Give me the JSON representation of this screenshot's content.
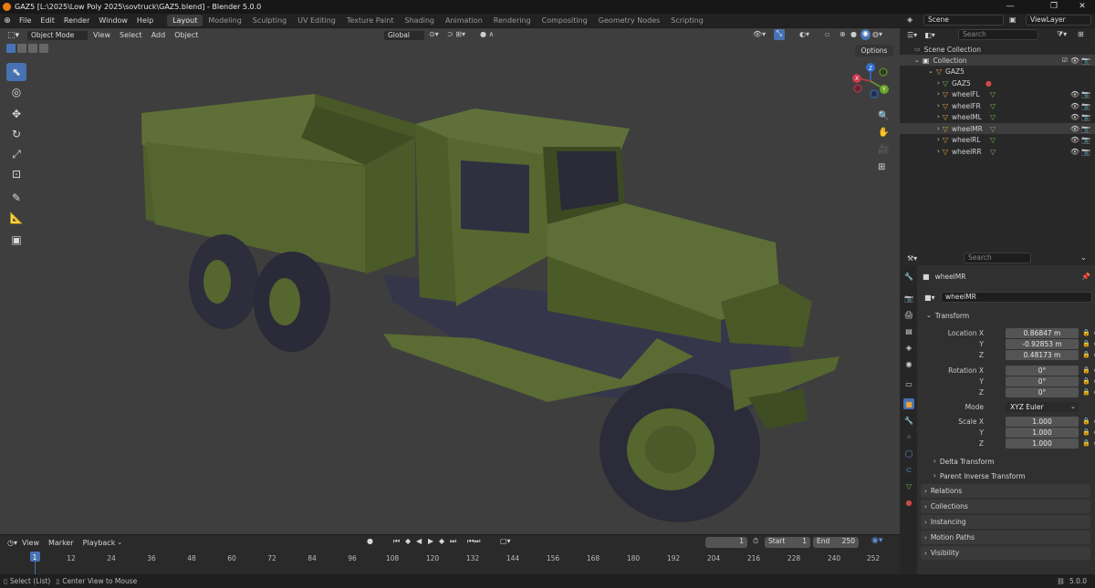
{
  "window": {
    "title": "GAZ5 [L:\\2025\\Low Poly 2025\\sovtruck\\GAZ5.blend] - Blender 5.0.0",
    "controls": [
      "—",
      "❐",
      "✕"
    ]
  },
  "menus": [
    "File",
    "Edit",
    "Render",
    "Window",
    "Help"
  ],
  "workspaces": [
    "Layout",
    "Modeling",
    "Sculpting",
    "UV Editing",
    "Texture Paint",
    "Shading",
    "Animation",
    "Rendering",
    "Compositing",
    "Geometry Nodes",
    "Scripting"
  ],
  "active_workspace": "Layout",
  "scene": {
    "label": "Scene",
    "view_layer": "ViewLayer"
  },
  "viewport": {
    "mode": "Object Mode",
    "menus": [
      "View",
      "Select",
      "Add",
      "Object"
    ],
    "transform_orientation": "Global",
    "options_label": "Options",
    "gizmo_axes": [
      "X",
      "Y",
      "Z"
    ],
    "colors": {
      "bg": "#3e3e3e",
      "truck_body": "#55662f",
      "wheels": "#2e2e3c",
      "accent": "#4772b3"
    }
  },
  "tools": [
    "select-box",
    "cursor",
    "move",
    "rotate",
    "scale",
    "transform",
    "annotate",
    "measure",
    "add-cube"
  ],
  "outliner": {
    "search_placeholder": "Search",
    "scene_collection": "Scene Collection",
    "items": [
      {
        "label": "Collection",
        "depth": 0
      },
      {
        "label": "GAZ5",
        "depth": 1
      },
      {
        "label": "GAZ5",
        "depth": 2
      },
      {
        "label": "wheelFL",
        "depth": 2
      },
      {
        "label": "wheelFR",
        "depth": 2
      },
      {
        "label": "wheelML",
        "depth": 2
      },
      {
        "label": "wheelMR",
        "depth": 2
      },
      {
        "label": "wheelRL",
        "depth": 2
      },
      {
        "label": "wheelRR",
        "depth": 2
      }
    ],
    "selected": "wheelMR"
  },
  "properties": {
    "search_placeholder": "Search",
    "object_name": "wheelMR",
    "datablock": "wheelMR",
    "transform_label": "Transform",
    "location_label": "Location X",
    "rotation_label": "Rotation X",
    "scale_label": "Scale X",
    "axis_y": "Y",
    "axis_z": "Z",
    "location": [
      "0.86847 m",
      "-0.92853 m",
      "0.48173 m"
    ],
    "rotation": [
      "0°",
      "0°",
      "0°"
    ],
    "mode_label": "Mode",
    "mode_value": "XYZ Euler",
    "scale": [
      "1.000",
      "1.000",
      "1.000"
    ],
    "subpanels": [
      "Delta Transform",
      "Parent Inverse Transform"
    ],
    "panels": [
      "Relations",
      "Collections",
      "Instancing",
      "Motion Paths",
      "Visibility"
    ]
  },
  "timeline": {
    "menus": [
      "View",
      "Marker",
      "Playback"
    ],
    "current_frame": "1",
    "start_label": "Start",
    "start": "1",
    "end_label": "End",
    "end": "250",
    "ticks": [
      "1",
      "12",
      "24",
      "36",
      "48",
      "60",
      "72",
      "84",
      "96",
      "108",
      "120",
      "132",
      "144",
      "156",
      "168",
      "180",
      "192",
      "204",
      "216",
      "228",
      "240",
      "252"
    ]
  },
  "statusbar": {
    "left1": "Select (List)",
    "left2": "Center View to Mouse",
    "version": "5.0.0"
  }
}
